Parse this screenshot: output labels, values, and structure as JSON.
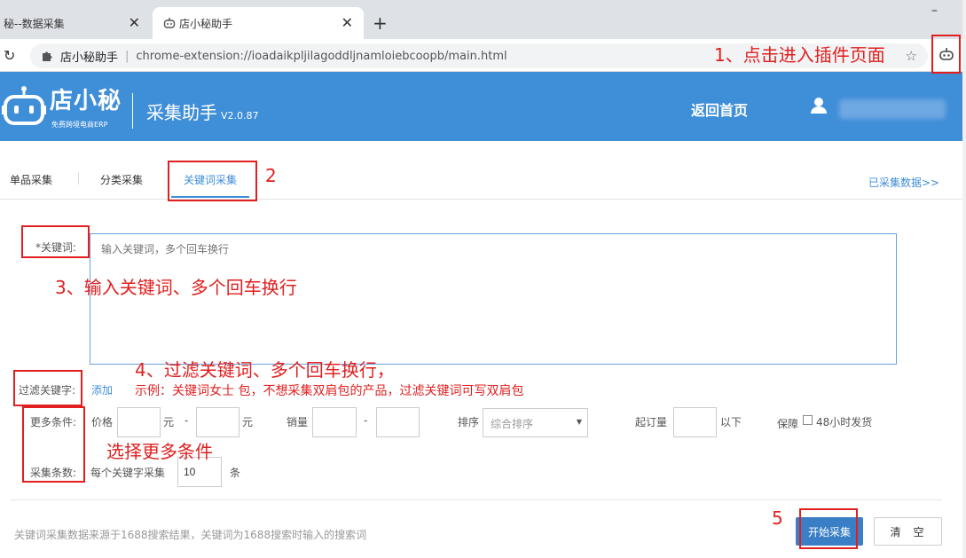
{
  "browser": {
    "tab1_title": "秘--数据采集",
    "tab2_title": "店小秘助手",
    "tab_close": "✕",
    "new_tab": "+",
    "minimize": "–",
    "reload_icon": "↻",
    "omnibox_name": "店小秘助手",
    "omnibox_sep": "|",
    "url": "chrome-extension://ioadaikpljilagoddljnamloiebcoopb/main.html",
    "star": "☆"
  },
  "header": {
    "logo_name": "店小秘",
    "logo_sub": "免费跨境电商ERP",
    "app_title": "采集助手",
    "version": "V2.0.87",
    "home_link": "返回首页",
    "brand_color": "#3f8ed8"
  },
  "tabs": {
    "items": [
      "单品采集",
      "分类采集",
      "关键词采集"
    ],
    "active": "关键词采集",
    "collected_link": "已采集数据>>"
  },
  "form": {
    "keyword_label": "*关键词:",
    "keyword_placeholder": "输入关键词，多个回车换行",
    "filter_label": "过滤关键字:",
    "filter_add": "添加",
    "more_label": "更多条件:",
    "price_label": "价格",
    "yuan": "元",
    "dash": "-",
    "sales_label": "销量",
    "sort_label": "排序",
    "sort_value": "综合排序",
    "min_order_label": "起订量",
    "below": "以下",
    "guarantee_label": "保障",
    "ship48_label": "48小时发货",
    "count_label": "采集条数:",
    "per_keyword_label": "每个关键字采集",
    "count_value": "10",
    "count_unit": "条",
    "footnote": "关键词采集数据来源于1688搜索结果，关键词为1688搜索时输入的搜索词",
    "start_button": "开始采集",
    "clear_button": "清空"
  },
  "annotations": {
    "step1": "1、点击进入插件页面",
    "step2": "2",
    "step3": "3、输入关键词、多个回车换行",
    "step4": "4、过滤关键词、多个回车换行，",
    "step4_example": "示例：关键词女士 包，不想采集双肩包的产品，过滤关键词可写双肩包",
    "more_hint": "选择更多条件",
    "step5": "5",
    "color": "#e02020"
  }
}
